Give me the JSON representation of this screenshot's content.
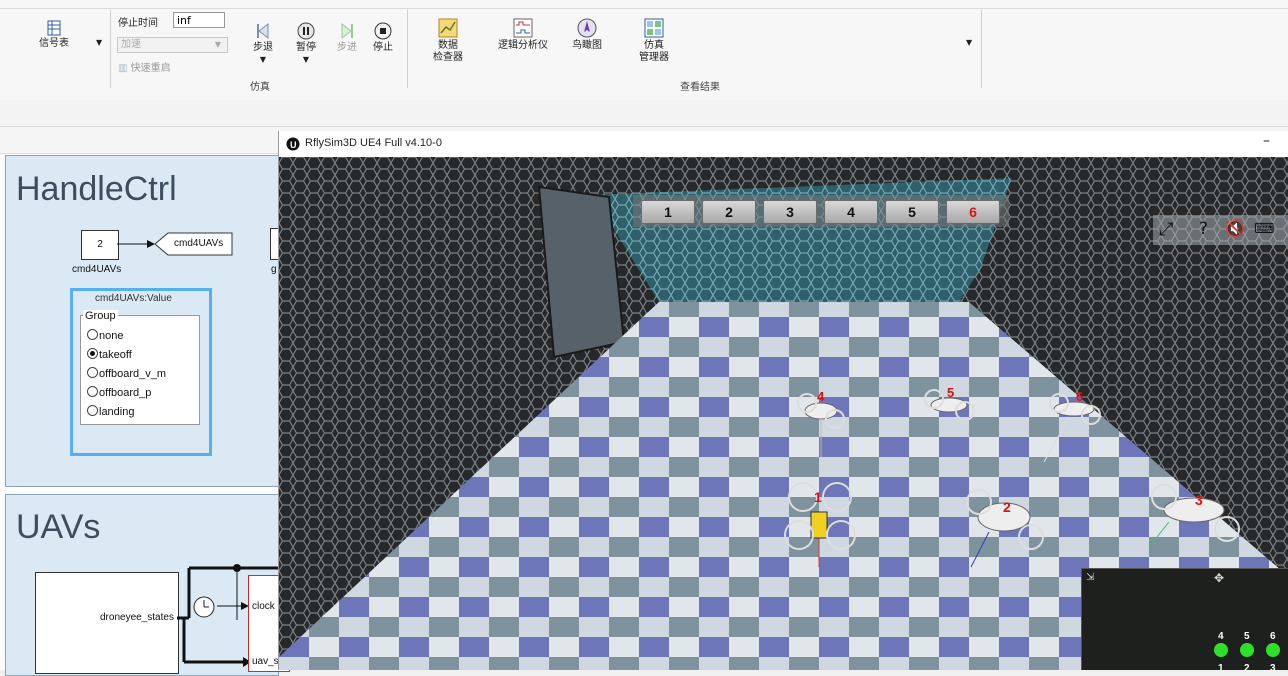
{
  "ribbon": {
    "signal_table_label": "信号表",
    "stop_time_label": "停止时间",
    "stop_time_value": "inf",
    "accel_selected": "加速",
    "fast_restart_label": "快速重启",
    "step_back_label": "步退",
    "pause_label": "暂停",
    "step_forward_label": "步进",
    "stop_label": "停止",
    "sim_group_label": "仿真",
    "data_inspector_label1": "数据",
    "data_inspector_label2": "检查器",
    "logic_analyzer_label": "逻辑分析仪",
    "birdseye_label": "鸟瞰图",
    "sim_manager_label1": "仿真",
    "sim_manager_label2": "管理器",
    "results_group_label": "查看结果"
  },
  "model": {
    "handlectrl_title": "HandleCtrl",
    "const_value": "2",
    "const_label": "cmd4UAVs",
    "goto_tag": "cmd4UAVs",
    "partial_label": "g",
    "dashboard_title": "cmd4UAVs:Value",
    "group_label": "Group",
    "options": [
      "none",
      "takeoff",
      "offboard_v_m",
      "offboard_p",
      "landing"
    ],
    "selected_option": "takeoff",
    "uavs_title": "UAVs",
    "states_port": "droneyee_states",
    "clock_label": "clock",
    "uav_port_partial": "uav_s"
  },
  "rflysim": {
    "window_title": "RflySim3D UE4 Full v4.10-0",
    "minimize_symbol": "–",
    "number_buttons": [
      "1",
      "2",
      "3",
      "4",
      "5",
      "6"
    ],
    "active_button": "6",
    "drone_labels": [
      "1",
      "2",
      "3",
      "4",
      "5",
      "6"
    ],
    "minimap_numbers": [
      "4",
      "5",
      "6",
      "1",
      "2",
      "3"
    ]
  },
  "colors": {
    "area_fill": "#dbe9f5",
    "dashboard_border": "#55b0f0",
    "label_red": "#e01010",
    "minimap_green": "#2fe02a"
  }
}
